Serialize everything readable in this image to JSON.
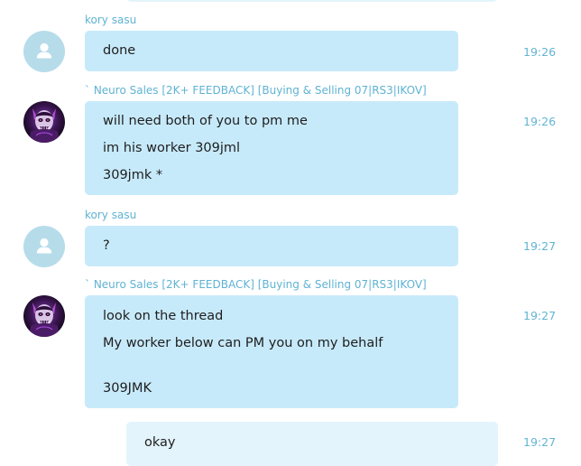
{
  "messages": [
    {
      "sender": "kory sasu",
      "avatar": "default-user-icon",
      "time": "19:26",
      "lines": [
        "done"
      ]
    },
    {
      "sender": "` Neuro Sales [2K+ FEEDBACK] [Buying & Selling 07|RS3|IKOV]",
      "avatar": "neuro-sales-avatar",
      "time": "19:26",
      "lines": [
        "will need both of you to pm me",
        "im his worker 309jml",
        "309jmk *"
      ]
    },
    {
      "sender": "kory sasu",
      "avatar": "default-user-icon",
      "time": "19:27",
      "lines": [
        "?"
      ]
    },
    {
      "sender": "` Neuro Sales [2K+ FEEDBACK] [Buying & Selling 07|RS3|IKOV]",
      "avatar": "neuro-sales-avatar",
      "time": "19:27",
      "lines": [
        "look on the thread",
        "My worker below can PM you on my behalf",
        "",
        "309JMK"
      ]
    },
    {
      "sender": "",
      "avatar": "",
      "time": "19:27",
      "lines": [
        "okay"
      ],
      "own": true
    }
  ],
  "colors": {
    "bubble_incoming": "#c7eafb",
    "bubble_outgoing": "#e3f4fc",
    "sender_name": "#5fb3d3",
    "timestamp": "#62b4d4",
    "default_avatar": "#b6dcea"
  }
}
